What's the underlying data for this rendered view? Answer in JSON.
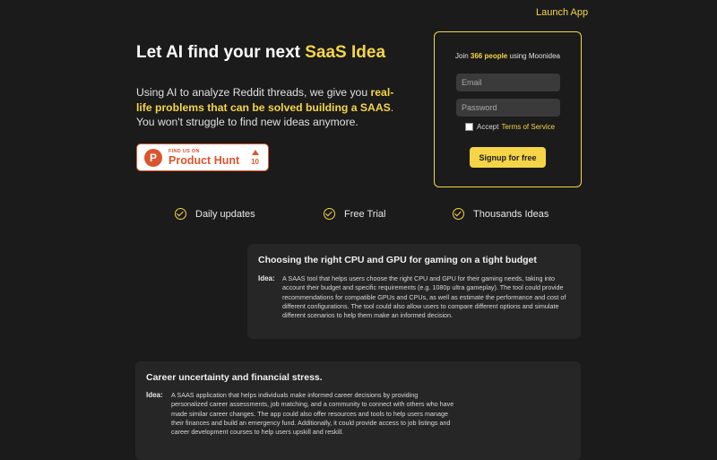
{
  "nav": {
    "launch_app": "Launch App"
  },
  "hero": {
    "title_prefix": "Let AI find your next ",
    "title_accent": "SaaS Idea",
    "desc_part1": "Using AI to analyze Reddit threads, we give you ",
    "desc_highlight": "real-life problems that can be solved building a SAAS",
    "desc_part2": ". You won't struggle to find new ideas anymore."
  },
  "product_hunt": {
    "small": "FIND US ON",
    "name": "Product Hunt",
    "logo_letter": "P",
    "votes": "10"
  },
  "signup": {
    "join_prefix": "Join ",
    "join_count": "366 people",
    "join_suffix": " using Moonidea",
    "email_placeholder": "Email",
    "password_placeholder": "Password",
    "accept": "Accept",
    "terms": "Terms of Service",
    "button": "Signup for free"
  },
  "features": [
    {
      "label": "Daily updates",
      "icon": "check-circle-icon"
    },
    {
      "label": "Free Trial",
      "icon": "check-circle-icon"
    },
    {
      "label": "Thousands Ideas",
      "icon": "check-circle-icon"
    }
  ],
  "ideas": [
    {
      "title": "Choosing the right CPU and GPU for gaming on a tight budget",
      "label": "Idea:",
      "text": "A SAAS tool that helps users choose the right CPU and GPU for their gaming needs, taking into account their budget and specific requirements (e.g. 1080p ultra gameplay). The tool could provide recommendations for compatible GPUs and CPUs, as well as estimate the performance and cost of different configurations. The tool could also allow users to compare different options and simulate different scenarios to help them make an informed decision."
    },
    {
      "title": "Career uncertainty and financial stress.",
      "label": "Idea:",
      "text": "A SAAS application that helps individuals make informed career decisions by providing personalized career assessments, job matching, and a community to connect with others who have made similar career changes. The app could also offer resources and tools to help users manage their finances and build an emergency fund. Additionally, it could provide access to job listings and career development courses to help users upskill and reskill."
    }
  ],
  "colors": {
    "background": "#1b1b1b",
    "accent": "#f5d547",
    "card": "#262626",
    "product_hunt": "#da552f"
  }
}
